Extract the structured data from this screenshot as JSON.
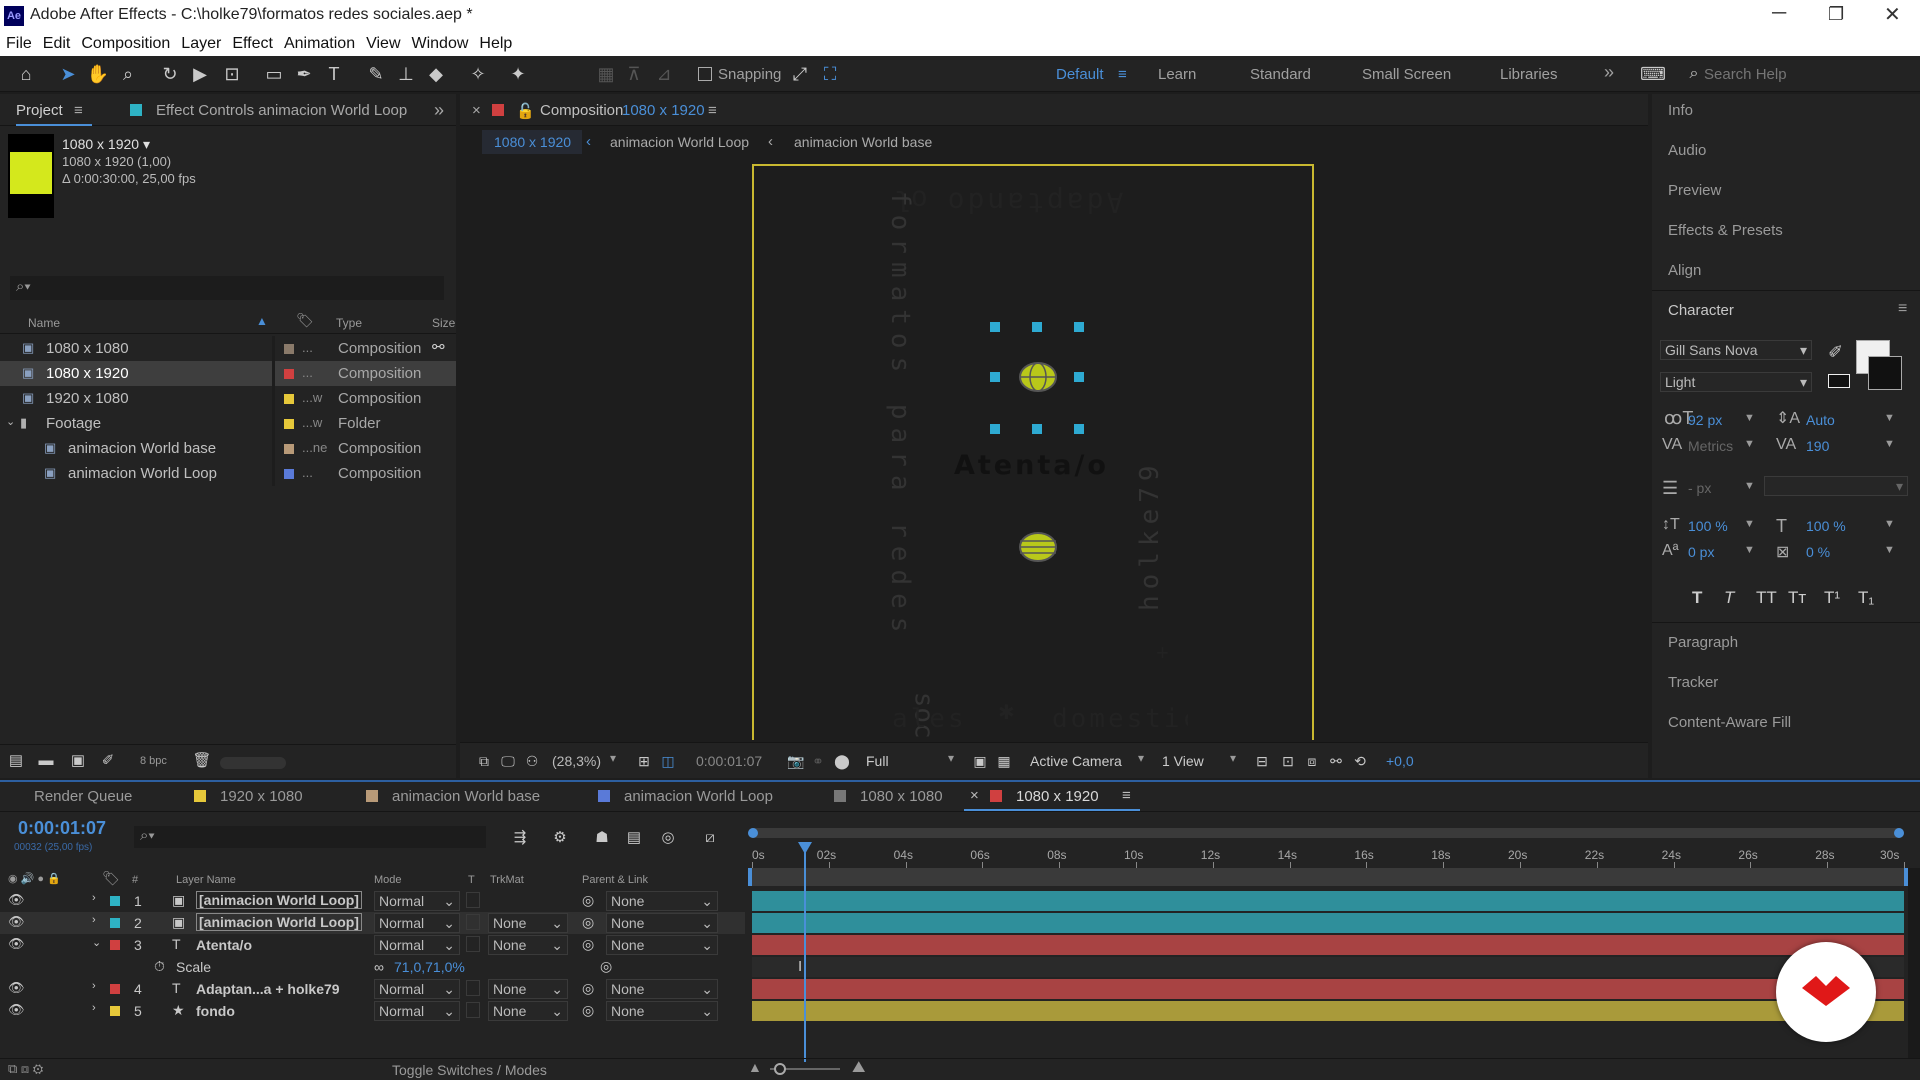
{
  "window": {
    "app_icon": "Ae",
    "title": "Adobe After Effects - C:\\holke79\\formatos redes sociales.aep *",
    "controls": [
      "─",
      "❐",
      "✕"
    ]
  },
  "menu": [
    "File",
    "Edit",
    "Composition",
    "Layer",
    "Effect",
    "Animation",
    "View",
    "Window",
    "Help"
  ],
  "toolbar": {
    "snapping": "Snapping",
    "workspaces": [
      "Default",
      "Learn",
      "Standard",
      "Small Screen",
      "Libraries"
    ],
    "active_workspace": "Default",
    "more": "»",
    "search_placeholder": "Search Help"
  },
  "project_panel": {
    "tab": "Project",
    "tab2": "Effect Controls animacion World Loop",
    "selected_name": "1080 x 1920 ▾",
    "selected_dims": "1080 x 1920 (1,00)",
    "selected_duration": "Δ 0:00:30:00, 25,00 fps",
    "columns": {
      "name": "Name",
      "type": "Type",
      "size": "Size"
    },
    "items": [
      {
        "name": "1080 x 1080",
        "color": "#8a7a6a",
        "dots": "...",
        "type": "Composition"
      },
      {
        "name": "1080 x 1920",
        "color": "#d04040",
        "dots": "...",
        "type": "Composition",
        "selected": true
      },
      {
        "name": "1920 x 1080",
        "color": "#e6c83a",
        "dots": "...w",
        "type": "Composition"
      },
      {
        "name": "Footage",
        "color": "#e6c83a",
        "dots": "...w",
        "type": "Folder",
        "folder": true
      },
      {
        "name": "animacion World base",
        "color": "#b89a78",
        "dots": "...ne",
        "type": "Composition",
        "indent": true
      },
      {
        "name": "animacion World Loop",
        "color": "#5a7ad8",
        "dots": "...",
        "type": "Composition",
        "indent": true
      }
    ],
    "bpc": "8 bpc"
  },
  "composition": {
    "tab_label": "Composition",
    "tab_name": "1080 x 1920",
    "breadcrumbs": [
      "1080 x 1920",
      "animacion World Loop",
      "animacion World base"
    ],
    "canvas": {
      "bg": "#d4e81c",
      "top_text": "Adaptando",
      "top_small": "ol",
      "left_text": "formatos para redes",
      "bottom_left": "ales",
      "bottom_left_prefix": "soci",
      "bottom_asterisk": "✱",
      "bottom_right": "domestic",
      "center_text": "Atenta/o",
      "right_text": "holke79",
      "plus": "+"
    },
    "footer": {
      "zoom": "(28,3%)",
      "time": "0:00:01:07",
      "resolution": "Full",
      "camera": "Active Camera",
      "views": "1 View",
      "exposure": "+0,0"
    }
  },
  "right_panel": {
    "items": [
      "Info",
      "Audio",
      "Preview",
      "Effects & Presets",
      "Align"
    ],
    "character": {
      "title": "Character",
      "font": "Gill Sans Nova",
      "style": "Light",
      "size": "92 px",
      "leading": "Auto",
      "kerning": "Metrics",
      "tracking": "190",
      "stroke": "- px",
      "vscale": "100 %",
      "hscale": "100 %",
      "baseline": "0 px",
      "tsume": "0 %",
      "styles": [
        "T",
        "T",
        "TT",
        "Tт",
        "T¹",
        "T₁"
      ]
    },
    "bottom_items": [
      "Paragraph",
      "Tracker",
      "Content-Aware Fill"
    ]
  },
  "timeline": {
    "tabs": [
      {
        "label": "Render Queue",
        "color": ""
      },
      {
        "label": "1920 x 1080",
        "color": "#e6c83a"
      },
      {
        "label": "animacion World base",
        "color": "#b89a78"
      },
      {
        "label": "animacion World Loop",
        "color": "#5a7ad8"
      },
      {
        "label": "1080 x 1080",
        "color": "#777777"
      },
      {
        "label": "1080 x 1920",
        "color": "#d04040",
        "active": true
      }
    ],
    "current_time": "0:00:01:07",
    "frame_info": "00032 (25,00 fps)",
    "columns": {
      "layer_name": "Layer Name",
      "mode": "Mode",
      "t": "T",
      "trkmat": "TrkMat",
      "parent": "Parent & Link",
      "num": "#"
    },
    "ruler": [
      "0s",
      "02s",
      "04s",
      "06s",
      "08s",
      "10s",
      "12s",
      "14s",
      "16s",
      "18s",
      "20s",
      "22s",
      "24s",
      "26s",
      "28s",
      "30s"
    ],
    "layers": [
      {
        "num": "1",
        "name": "[animacion World Loop]",
        "color": "#2eb2c4",
        "icon": "comp",
        "mode": "Normal",
        "trkmat": "",
        "parent": "None",
        "bar": "#2f8f9b"
      },
      {
        "num": "2",
        "name": "[animacion World Loop]",
        "color": "#2eb2c4",
        "icon": "comp",
        "mode": "Normal",
        "trkmat": "None",
        "parent": "None",
        "bar": "#2f8f9b"
      },
      {
        "num": "3",
        "name": "Atenta/o",
        "color": "#d04040",
        "icon": "T",
        "mode": "Normal",
        "trkmat": "None",
        "parent": "None",
        "bar": "#a84343",
        "expanded": true
      },
      {
        "num": "4",
        "name": "Adaptan...a  +  holke79",
        "color": "#d04040",
        "icon": "T",
        "mode": "Normal",
        "trkmat": "None",
        "parent": "None",
        "bar": "#a84343"
      },
      {
        "num": "5",
        "name": "fondo",
        "color": "#e6c83a",
        "icon": "★",
        "mode": "Normal",
        "trkmat": "None",
        "parent": "None",
        "bar": "#a99a3a"
      }
    ],
    "scale_prop": {
      "label": "Scale",
      "value": "71,0,71,0%"
    },
    "toggle_label": "Toggle Switches / Modes",
    "playhead_fraction": 0.045
  }
}
